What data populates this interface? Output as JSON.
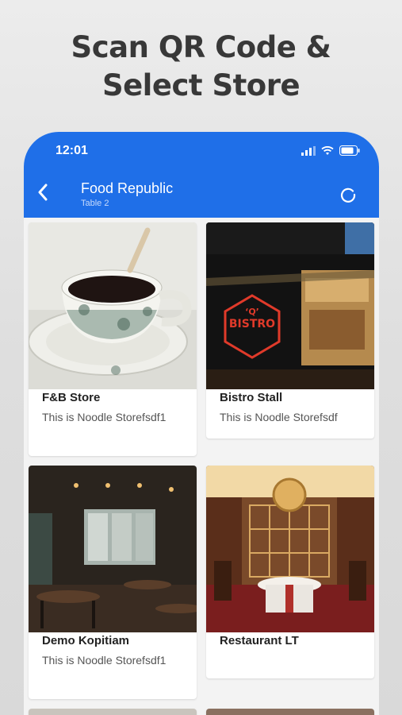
{
  "headline": {
    "line1": "Scan QR Code &",
    "line2": "Select Store"
  },
  "status_bar": {
    "time": "12:01"
  },
  "app_bar": {
    "title": "Food Republic",
    "subtitle": "Table 2"
  },
  "stores": [
    {
      "name": "F&B Store",
      "description": "This is Noodle Storefsdf1"
    },
    {
      "name": "Bistro Stall",
      "description": "This is Noodle Storefsdf"
    },
    {
      "name": "Demo Kopitiam",
      "description": "This is Noodle Storefsdf1"
    },
    {
      "name": "Restaurant LT",
      "description": ""
    }
  ],
  "colors": {
    "primary": "#1f6fe8",
    "background": "#f3f3f3"
  }
}
